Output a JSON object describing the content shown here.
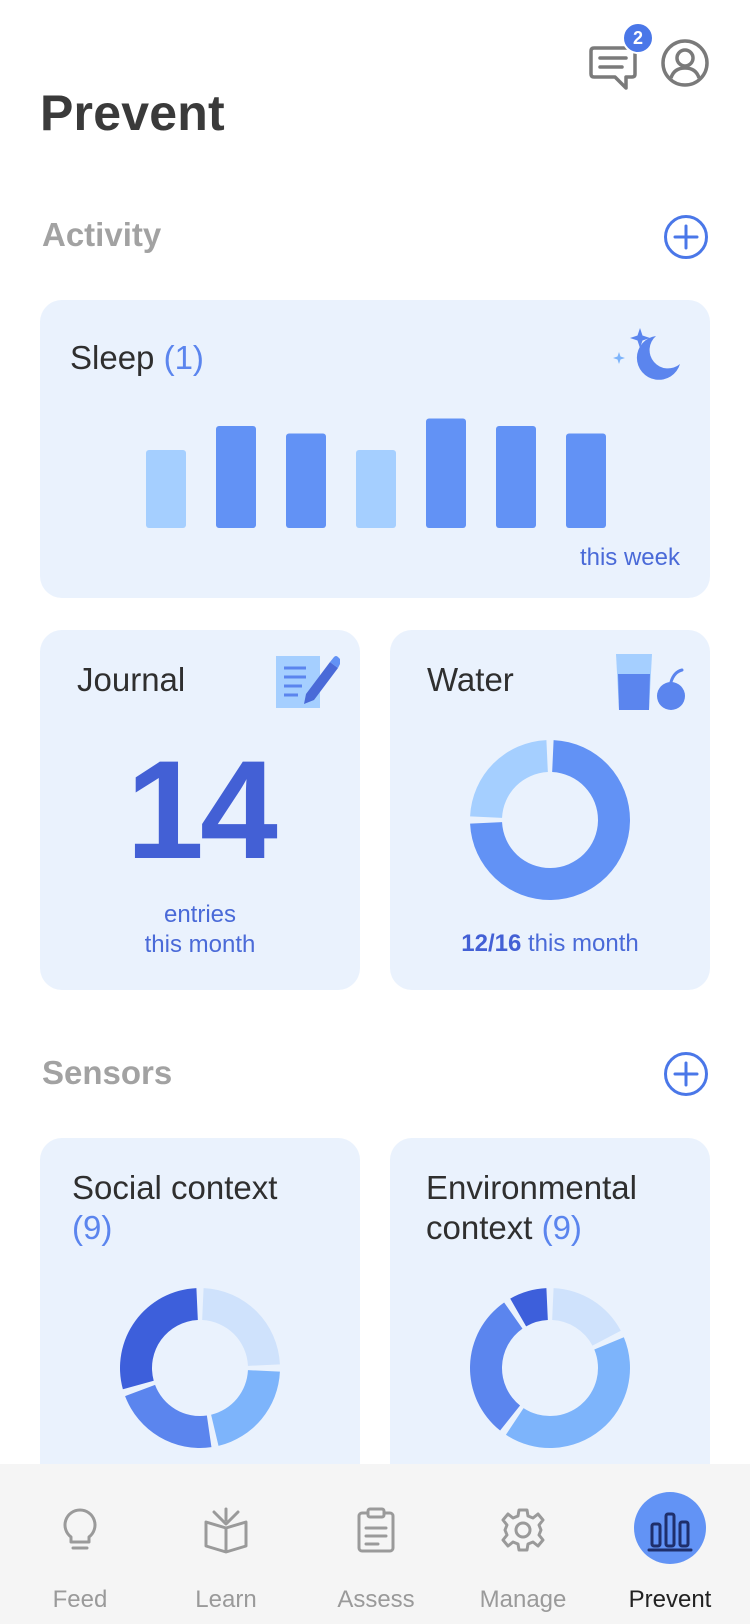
{
  "header": {
    "title": "Prevent",
    "message_badge": "2",
    "icons": [
      "message-icon",
      "profile-icon"
    ]
  },
  "activity": {
    "title": "Activity",
    "sleep": {
      "label": "Sleep",
      "count": "(1)",
      "period": "this week",
      "bar_levels": [
        0.52,
        0.68,
        0.63,
        0.52,
        0.73,
        0.68,
        0.63
      ],
      "bar_colors": [
        "#a5cfff",
        "#6292f5",
        "#6292f5",
        "#a5cfff",
        "#6292f5",
        "#6292f5",
        "#6292f5"
      ]
    },
    "journal": {
      "label": "Journal",
      "value": "14",
      "sub_line1": "entries",
      "sub_line2": "this month"
    },
    "water": {
      "label": "Water",
      "done": "12/16",
      "period": " this month",
      "progress": 0.75
    }
  },
  "sensors": {
    "title": "Sensors",
    "social": {
      "label": "Social context",
      "count": "(9)",
      "segments": [
        {
          "fraction": 0.25,
          "color": "#cfe2fc"
        },
        {
          "fraction": 0.22,
          "color": "#7db4fb"
        },
        {
          "fraction": 0.23,
          "color": "#5b85ee"
        },
        {
          "fraction": 0.3,
          "color": "#3d5fdb"
        }
      ]
    },
    "environmental": {
      "label_line1": "Environmental",
      "label_line2": "context",
      "count": "(9)",
      "segments": [
        {
          "fraction": 0.18,
          "color": "#cfe2fc"
        },
        {
          "fraction": 0.42,
          "color": "#7db4fb"
        },
        {
          "fraction": 0.31,
          "color": "#5b85ee"
        },
        {
          "fraction": 0.09,
          "color": "#3d5fdb"
        }
      ]
    }
  },
  "tabs": [
    {
      "label": "Feed",
      "icon": "lightbulb-icon"
    },
    {
      "label": "Learn",
      "icon": "book-icon"
    },
    {
      "label": "Assess",
      "icon": "clipboard-icon"
    },
    {
      "label": "Manage",
      "icon": "gear-icon"
    },
    {
      "label": "Prevent",
      "icon": "bar-chart-icon",
      "active": true
    }
  ],
  "colors": {
    "accent": "#4a77e8",
    "card_bg": "#eaf2fd",
    "big_number": "#4360d5"
  }
}
